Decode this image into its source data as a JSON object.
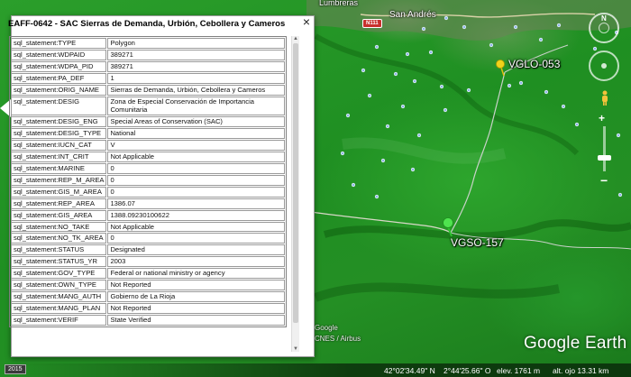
{
  "map": {
    "places": [
      "San Andrés",
      "Lumbreras"
    ],
    "road_shield": "N111",
    "pins": [
      {
        "label": "VGLO-053",
        "color": "#f1d21b"
      },
      {
        "label": "VGSO-157",
        "color": "#4fe34f"
      }
    ],
    "brand": "Google Earth",
    "credits": [
      "Google",
      "CNES / Airbus"
    ],
    "status": {
      "year": "2015",
      "lat": "42°02'34.49\" N",
      "lon": "2°44'25.66\" O",
      "elev": "elev.  1761 m",
      "eye": "alt. ojo  13.31 km"
    },
    "compass_label": "N"
  },
  "popup": {
    "title": "EAFF-0642 - SAC Sierras de Demanda, Urbión, Cebollera y Cameros",
    "close_label": "×",
    "rows": [
      {
        "k": "sql_statement:TYPE",
        "v": "Polygon"
      },
      {
        "k": "sql_statement:WDPAID",
        "v": "389271"
      },
      {
        "k": "sql_statement:WDPA_PID",
        "v": "389271"
      },
      {
        "k": "sql_statement:PA_DEF",
        "v": "1"
      },
      {
        "k": "sql_statement:ORIG_NAME",
        "v": "Sierras de Demanda, Urbión, Cebollera y Cameros"
      },
      {
        "k": "sql_statement:DESIG",
        "v": "Zona de Especial Conservación de Importancia Comunitaria"
      },
      {
        "k": "sql_statement:DESIG_ENG",
        "v": "Special Areas of Conservation (SAC)"
      },
      {
        "k": "sql_statement:DESIG_TYPE",
        "v": "National"
      },
      {
        "k": "sql_statement:IUCN_CAT",
        "v": "V"
      },
      {
        "k": "sql_statement:INT_CRIT",
        "v": "Not Applicable"
      },
      {
        "k": "sql_statement:MARINE",
        "v": "0"
      },
      {
        "k": "sql_statement:REP_M_AREA",
        "v": "0"
      },
      {
        "k": "sql_statement:GIS_M_AREA",
        "v": "0"
      },
      {
        "k": "sql_statement:REP_AREA",
        "v": "1386.07"
      },
      {
        "k": "sql_statement:GIS_AREA",
        "v": "1388.09230100622"
      },
      {
        "k": "sql_statement:NO_TAKE",
        "v": "Not Applicable"
      },
      {
        "k": "sql_statement:NO_TK_AREA",
        "v": "0"
      },
      {
        "k": "sql_statement:STATUS",
        "v": "Designated"
      },
      {
        "k": "sql_statement:STATUS_YR",
        "v": "2003"
      },
      {
        "k": "sql_statement:GOV_TYPE",
        "v": "Federal or national ministry or agency"
      },
      {
        "k": "sql_statement:OWN_TYPE",
        "v": "Not Reported"
      },
      {
        "k": "sql_statement:MANG_AUTH",
        "v": "Gobierno de La Rioja"
      },
      {
        "k": "sql_statement:MANG_PLAN",
        "v": "Not Reported"
      },
      {
        "k": "sql_statement:VERIF",
        "v": "State Verified"
      }
    ]
  }
}
